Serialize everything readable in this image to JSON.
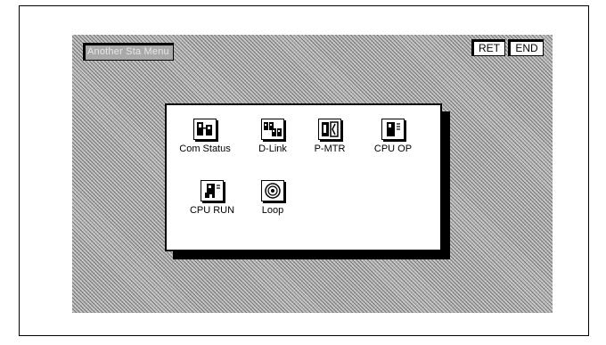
{
  "title": "Another Sta Menu",
  "buttons": {
    "ret": "RET",
    "end": "END"
  },
  "menu": {
    "com_status": "Com Status",
    "d_link": "D-Link",
    "p_mtr": "P-MTR",
    "cpu_op": "CPU OP",
    "cpu_run": "CPU RUN",
    "loop": "Loop"
  },
  "icons": [
    "com-status-icon",
    "d-link-icon",
    "p-mtr-icon",
    "cpu-op-icon",
    "cpu-run-icon",
    "loop-icon"
  ]
}
